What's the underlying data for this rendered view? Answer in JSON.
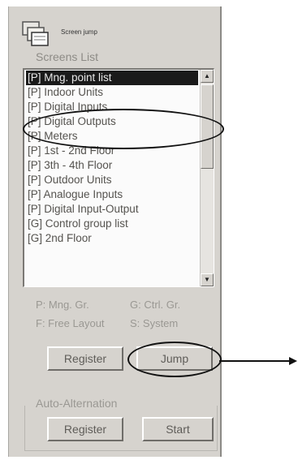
{
  "window": {
    "title": "Screen jump"
  },
  "screens_list": {
    "label": "Screens List",
    "items": [
      "[P] Mng. point list",
      "[P] Indoor Units",
      "[P] Digital Inputs",
      "[P] Digital Outputs",
      "[P] Meters",
      "[P] 1st - 2nd Floor",
      "[P] 3th - 4th Floor",
      "[P] Outdoor Units",
      "[P] Analogue Inputs",
      "[P] Digital Input-Output",
      "[G] Control group list",
      "[G] 2nd Floor"
    ],
    "selected_index": 0
  },
  "legend": {
    "p": "P: Mng. Gr.",
    "g": "G: Ctrl. Gr.",
    "f": "F: Free Layout",
    "s": "S: System"
  },
  "buttons": {
    "register": "Register",
    "jump": "Jump"
  },
  "auto_alternation": {
    "label": "Auto-Alternation",
    "register": "Register",
    "start": "Start"
  },
  "colors": {
    "panel": "#d6d3ce",
    "selection": "#1a1a1a",
    "annotation": "#111111"
  }
}
